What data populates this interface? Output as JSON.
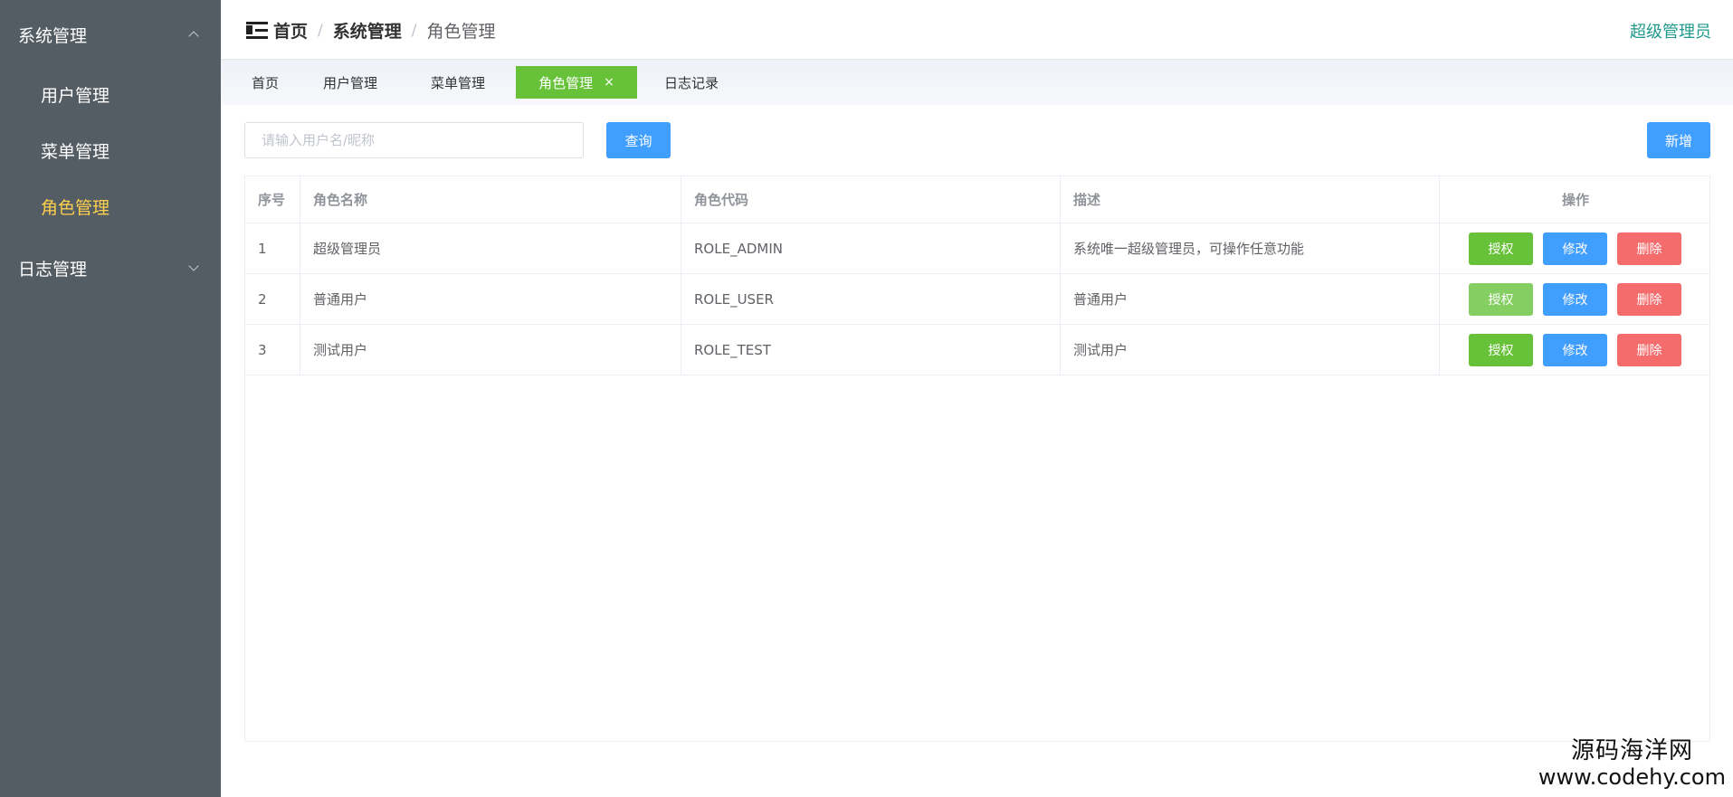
{
  "sidebar": {
    "groups": [
      {
        "label": "系统管理",
        "items": [
          {
            "label": "用户管理"
          },
          {
            "label": "菜单管理"
          },
          {
            "label": "角色管理"
          }
        ]
      },
      {
        "label": "日志管理"
      }
    ],
    "active_color": "#ffd04b",
    "background": "#545c64"
  },
  "header": {
    "breadcrumb": [
      "首页",
      "系统管理",
      "角色管理"
    ],
    "separator": "/",
    "user": "超级管理员"
  },
  "tabs": [
    {
      "label": "首页"
    },
    {
      "label": "用户管理"
    },
    {
      "label": "菜单管理"
    },
    {
      "label": "角色管理",
      "close": "×"
    },
    {
      "label": "日志记录"
    }
  ],
  "search": {
    "placeholder": "请输入用户名/昵称",
    "value": "",
    "search_label": "查询",
    "add_label": "新增"
  },
  "table": {
    "columns": [
      "序号",
      "角色名称",
      "角色代码",
      "描述",
      "操作"
    ],
    "rows": [
      {
        "index": "1",
        "name": "超级管理员",
        "code": "ROLE_ADMIN",
        "desc": "系统唯一超级管理员，可操作任意功能"
      },
      {
        "index": "2",
        "name": "普通用户",
        "code": "ROLE_USER",
        "desc": "普通用户"
      },
      {
        "index": "3",
        "name": "测试用户",
        "code": "ROLE_TEST",
        "desc": "测试用户"
      }
    ],
    "actions": {
      "grant": "授权",
      "edit": "修改",
      "delete": "删除"
    }
  },
  "watermark": {
    "name": "源码海洋网",
    "url": "www.codehy.com"
  },
  "colors": {
    "primary": "#409eff",
    "success": "#67c23a",
    "danger": "#f56c6c",
    "link": "#1f9a8c"
  }
}
